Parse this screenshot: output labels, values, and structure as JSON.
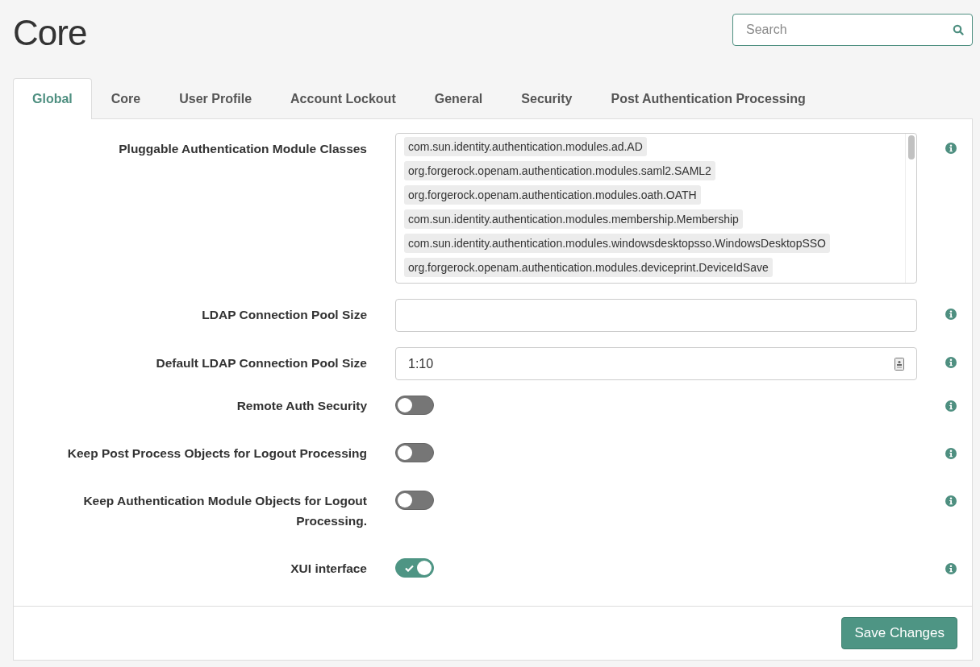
{
  "page_title": "Core",
  "search": {
    "placeholder": "Search"
  },
  "tabs": [
    {
      "label": "Global",
      "selected": true
    },
    {
      "label": "Core",
      "selected": false
    },
    {
      "label": "User Profile",
      "selected": false
    },
    {
      "label": "Account Lockout",
      "selected": false
    },
    {
      "label": "General",
      "selected": false
    },
    {
      "label": "Security",
      "selected": false
    },
    {
      "label": "Post Authentication Processing",
      "selected": false
    }
  ],
  "fields": [
    {
      "kind": "multiselect",
      "label": "Pluggable Authentication Module Classes",
      "values": [
        "com.sun.identity.authentication.modules.ad.AD",
        "org.forgerock.openam.authentication.modules.saml2.SAML2",
        "org.forgerock.openam.authentication.modules.oath.OATH",
        "com.sun.identity.authentication.modules.membership.Membership",
        "com.sun.identity.authentication.modules.windowsdesktopsso.WindowsDesktopSSO",
        "org.forgerock.openam.authentication.modules.deviceprint.DeviceIdSave"
      ]
    },
    {
      "kind": "text",
      "label": "LDAP Connection Pool Size"
    },
    {
      "kind": "text",
      "label": "Default LDAP Connection Pool Size",
      "value": "1:10"
    },
    {
      "kind": "toggle",
      "label": "Remote Auth Security",
      "on": false
    },
    {
      "kind": "toggle",
      "label": "Keep Post Process Objects for Logout Processing",
      "on": false
    },
    {
      "kind": "toggle",
      "label": "Keep Authentication Module Objects for Logout Processing.",
      "on": false
    },
    {
      "kind": "toggle",
      "label": "XUI interface",
      "on": true
    }
  ],
  "save_button": "Save Changes"
}
